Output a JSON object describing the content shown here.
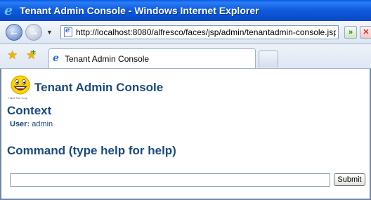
{
  "window": {
    "title": "Tenant Admin Console - Windows Internet Explorer"
  },
  "navbar": {
    "back_icon": "back-arrow-icon",
    "forward_icon": "forward-arrow-icon",
    "address": "http://localhost:8080/alfresco/faces/jsp/admin/tenantadmin-console.jsp",
    "go_icon": "refresh-go-icon",
    "stop_icon": "stop-icon"
  },
  "tabbar": {
    "tab_label": "Tenant Admin Console"
  },
  "page": {
    "logo_caption": "Have Fun Corp",
    "title": "Tenant Admin Console",
    "context_heading": "Context",
    "user_label": "User:",
    "user_value": "admin",
    "command_heading": "Command (type help for help)",
    "command_value": "",
    "submit_label": "Submit"
  },
  "colors": {
    "titlebar": "#0a5be6",
    "heading": "#1a4a7a",
    "frame_border": "#6f86ad"
  }
}
